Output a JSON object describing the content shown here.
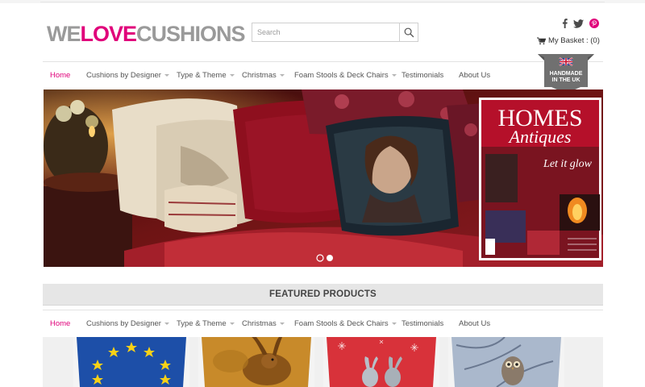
{
  "site": {
    "logo_parts": {
      "we": "WE",
      "love": "LOVE",
      "cushions": "CUSHIONS"
    }
  },
  "search": {
    "placeholder": "Search"
  },
  "social_icons": [
    "facebook-icon",
    "twitter-icon",
    "pinterest-icon"
  ],
  "basket": {
    "label": "My Basket : (0)"
  },
  "nav": {
    "items": [
      {
        "label": "Home",
        "active": true,
        "dropdown": false
      },
      {
        "label": "Cushions by Designer",
        "active": false,
        "dropdown": true
      },
      {
        "label": "Type & Theme",
        "active": false,
        "dropdown": true
      },
      {
        "label": "Christmas",
        "active": false,
        "dropdown": true
      },
      {
        "label": "Foam Stools & Deck Chairs",
        "active": false,
        "dropdown": true
      },
      {
        "label": "Testimonials",
        "active": false,
        "dropdown": false
      },
      {
        "label": "About Us",
        "active": false,
        "dropdown": false
      }
    ]
  },
  "badge": {
    "line1": "HANDMADE",
    "line2": "IN THE UK"
  },
  "hero": {
    "magazine_title_1": "HOMES",
    "magazine_title_2": "Antiques",
    "magazine_headline": "Let it glow",
    "slides": 2,
    "active_slide": 1
  },
  "featured": {
    "title": "FEATURED PRODUCTS"
  },
  "products": [
    "eu-flag-cushion",
    "hare-cushion",
    "red-hares-cushion",
    "owl-cushion"
  ],
  "colors": {
    "brand_pink": "#e0007a",
    "logo_grey": "#9a9a9a",
    "nav_text": "#555555"
  }
}
